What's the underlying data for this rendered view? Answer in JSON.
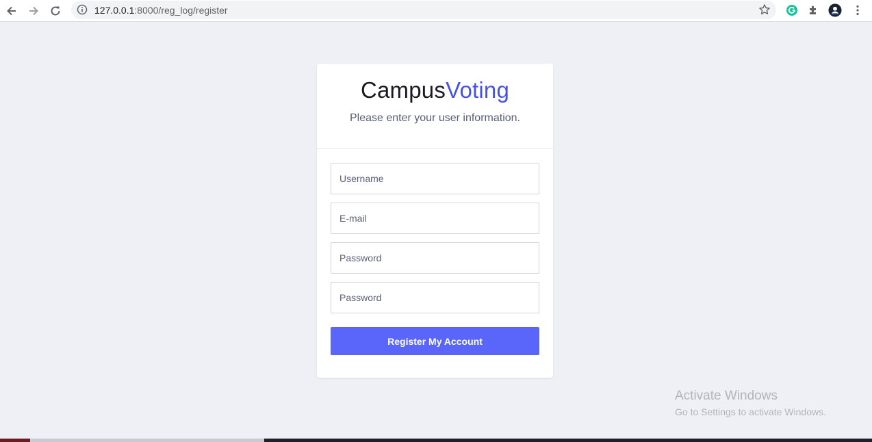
{
  "browser": {
    "url_host": "127.0.0.1",
    "url_path": ":8000/reg_log/register",
    "icons": [
      "back-arrow-icon",
      "forward-arrow-icon",
      "reload-icon",
      "info-icon",
      "star-icon",
      "grammarly-icon",
      "extensions-puzzle-icon",
      "profile-avatar-icon",
      "menu-kebab-icon"
    ]
  },
  "card": {
    "brand_part1": "Campus",
    "brand_part2": "Voting",
    "subtitle": "Please enter your user information.",
    "fields": {
      "username_placeholder": "Username",
      "email_placeholder": "E-mail",
      "password_placeholder": "Password",
      "password_confirm_placeholder": "Password"
    },
    "submit_label": "Register My Account"
  },
  "colors": {
    "accent": "#4452e8",
    "button": "#5a66fa",
    "background": "#eef0f5"
  },
  "watermark": {
    "line1": "Activate Windows",
    "line2": "Go to Settings to activate Windows."
  }
}
